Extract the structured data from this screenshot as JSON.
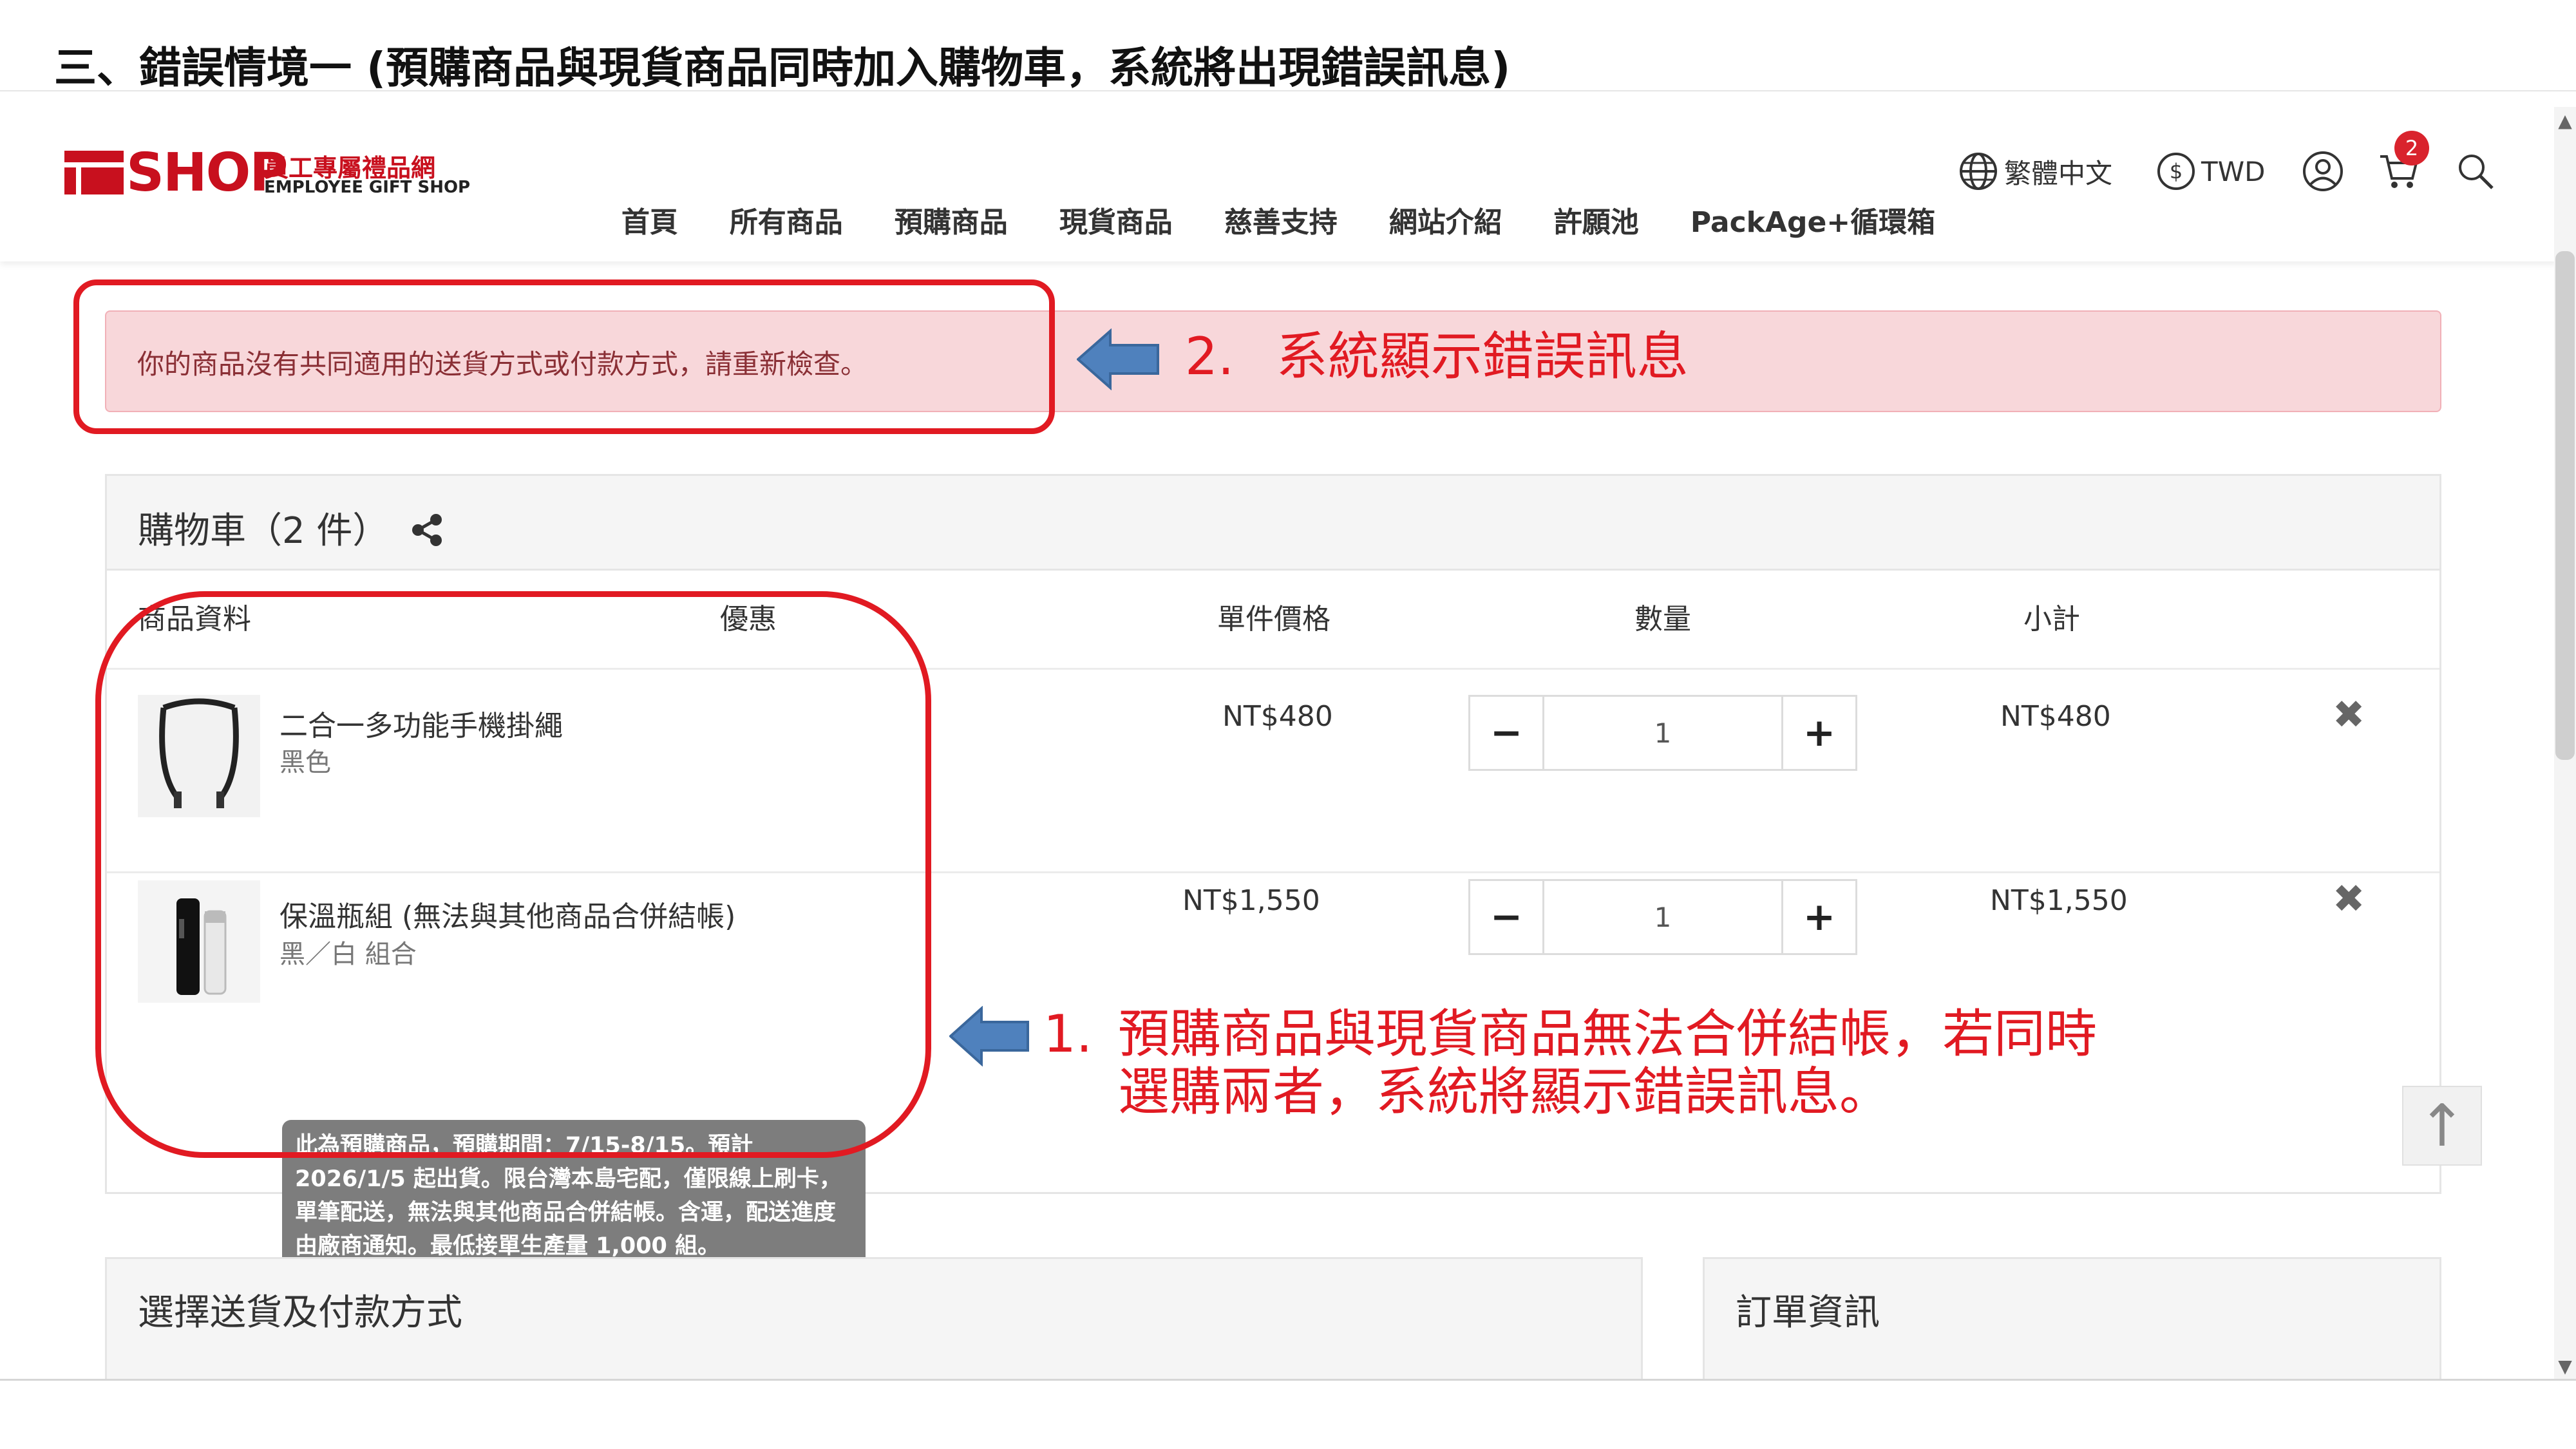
{
  "slide": {
    "title": "三、錯誤情境一 (預購商品與現貨商品同時加入購物車，系統將出現錯誤訊息)"
  },
  "header": {
    "logo": {
      "word": "SHOP",
      "cn": "員工專屬禮品網",
      "en": "EMPLOYEE GIFT SHOP"
    },
    "language_icon": "globe-icon",
    "language_label": "繁體中文",
    "currency_icon": "dollar-circle-icon",
    "currency_label": "TWD",
    "account_icon": "user-circle-icon",
    "cart_icon": "cart-icon",
    "cart_count": "2",
    "search_icon": "search-icon"
  },
  "nav": {
    "items": [
      {
        "label": "首頁"
      },
      {
        "label": "所有商品"
      },
      {
        "label": "預購商品"
      },
      {
        "label": "現貨商品"
      },
      {
        "label": "慈善支持"
      },
      {
        "label": "網站介紹"
      },
      {
        "label": "許願池"
      },
      {
        "label": "PackAge+循環箱"
      }
    ]
  },
  "alert": {
    "message": "你的商品沒有共同適用的送貨方式或付款方式，請重新檢查。"
  },
  "cart": {
    "title": "購物車（2 件）",
    "share_icon": "share-icon",
    "columns": {
      "product": "商品資料",
      "discount": "優惠",
      "unit_price": "單件價格",
      "quantity": "數量",
      "subtotal": "小計"
    },
    "items": [
      {
        "name": "二合一多功能手機掛繩",
        "variant": "黑色",
        "unit_price": "NT$480",
        "quantity": "1",
        "subtotal": "NT$480",
        "minus": "−",
        "plus": "+",
        "remove": "✖"
      },
      {
        "name": "保溫瓶組 (無法與其他商品合併結帳)",
        "variant": "黑／白 組合",
        "unit_price": "NT$1,550",
        "quantity": "1",
        "subtotal": "NT$1,550",
        "minus": "−",
        "plus": "+",
        "remove": "✖",
        "notice": "此為預購商品，預購期間：7/15-8/15。預計2026/1/5 起出貨。限台灣本島宅配，僅限線上刷卡，單筆配送，無法與其他商品合併結帳。含運，配送進度由廠商通知。最低接單生產量 1,000 組。"
      }
    ]
  },
  "panels": {
    "shipping_title": "選擇送貨及付款方式",
    "order_title": "訂單資訊"
  },
  "annotations": {
    "note1_number": "1.",
    "note1_line1": "預購商品與現貨商品無法合併結帳，若同時",
    "note1_line2": "選購兩者，系統將顯示錯誤訊息。",
    "note2_number": "2.",
    "note2_text": "系統顯示錯誤訊息",
    "color": "#e11a22",
    "arrow_color": "#4f81bd"
  },
  "misc": {
    "back_to_top": "↑"
  }
}
